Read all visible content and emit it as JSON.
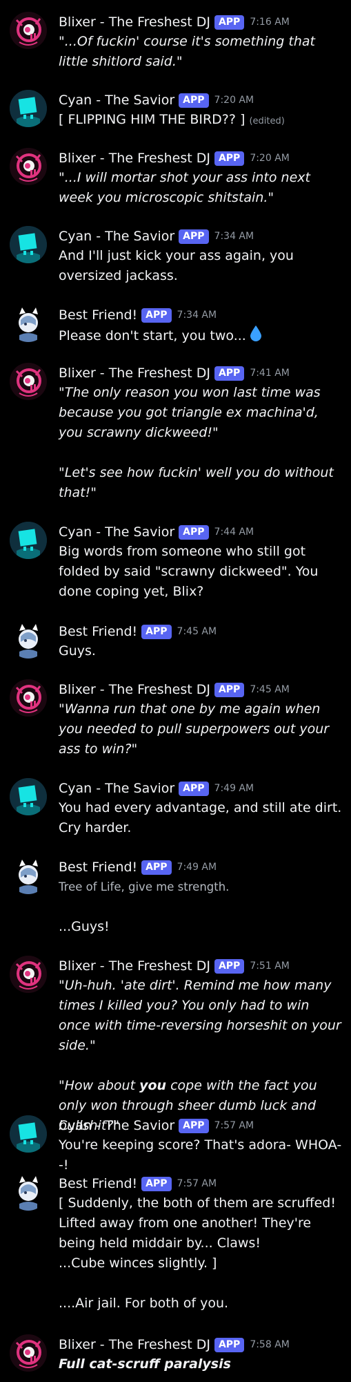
{
  "app": "APP",
  "messages": [
    {
      "author": "Blixer - The Freshest DJ",
      "time": "7:16 AM",
      "lines": [
        "\"...Of fuckin' course it's something that little shitlord said.\""
      ]
    },
    {
      "author": "Cyan - The Savior",
      "time": "7:20 AM",
      "text": "[ FLIPPING HIM THE BIRD?? ]",
      "edited": "(edited)"
    },
    {
      "author": "Blixer - The Freshest DJ",
      "time": "7:20 AM",
      "lines": [
        "\"...I will mortar shot your ass into next week you microscopic shitstain.\""
      ]
    },
    {
      "author": "Cyan - The Savior",
      "time": "7:34 AM",
      "lines": [
        "And I'll just kick your ass again, you oversized jackass."
      ]
    },
    {
      "author": "Best Friend!",
      "time": "7:34 AM",
      "text": "Please don't start, you two...",
      "emoji": "droplet-icon"
    },
    {
      "author": "Blixer - The Freshest DJ",
      "time": "7:41 AM",
      "lines": [
        "\"The only reason you won last time was because you got triangle ex machina'd, you scrawny dickweed!\"",
        "\"Let's see how fuckin' well you do without that!\""
      ]
    },
    {
      "author": "Cyan - The Savior",
      "time": "7:44 AM",
      "lines": [
        "Big words from someone who still got folded by said \"scrawny dickweed\". You done coping yet, Blix?"
      ]
    },
    {
      "author": "Best Friend!",
      "time": "7:45 AM",
      "lines": [
        "Guys."
      ]
    },
    {
      "author": "Blixer - The Freshest DJ",
      "time": "7:45 AM",
      "lines": [
        "\"Wanna run that one by me again when you needed to pull superpowers out your ass to win?\""
      ]
    },
    {
      "author": "Cyan - The Savior",
      "time": "7:49 AM",
      "lines": [
        "You had every advantage, and still ate dirt. Cry harder."
      ]
    },
    {
      "author": "Best Friend!",
      "time": "7:49 AM",
      "lines": [
        "Tree of Life, give me strength.",
        "...Guys!"
      ]
    },
    {
      "author": "Blixer - The Freshest DJ",
      "time": "7:51 AM",
      "lines": [
        "\"Uh-huh. 'ate dirt'. Remind me how many times I killed you? You only had to win once with time-reversing horseshit on your side.\""
      ],
      "line2_pre": "\"How about ",
      "line2_bold": "you",
      "line2_post": " cope with the fact you only won through sheer dumb luck and bullshit?\""
    },
    {
      "author": "Cyan - The Savior",
      "time": "7:57 AM",
      "lines": [
        "You're keeping score? That's adora- WHOA--!"
      ]
    },
    {
      "author": "Best Friend!",
      "time": "7:57 AM",
      "lines": [
        "[ Suddenly, the both of them are scruffed! Lifted away from one another! They're being held middair by... Claws!",
        "...Cube winces slightly. ]",
        "....Air jail. For both of you."
      ]
    },
    {
      "author": "Blixer - The Freshest DJ",
      "time": "7:58 AM",
      "lines": [
        "Full cat-scruff paralysis"
      ]
    }
  ]
}
